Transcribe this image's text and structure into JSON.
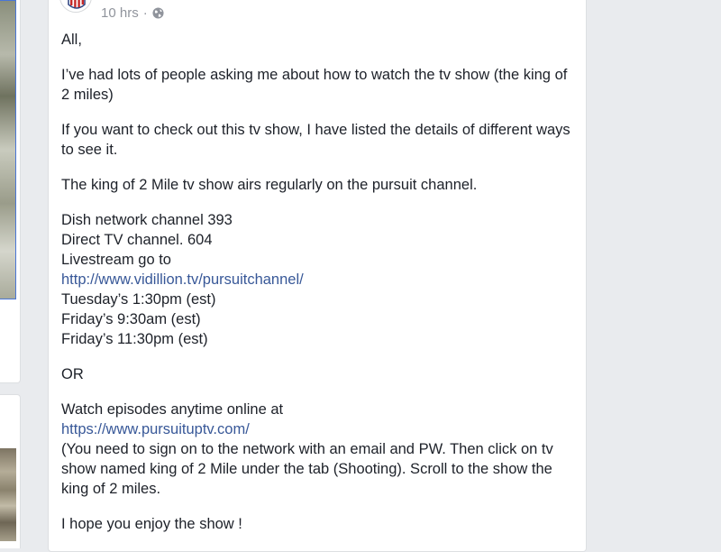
{
  "post": {
    "timestamp": "10 hrs",
    "separator": "·",
    "privacy_icon": "globe-icon",
    "greeting": "All,",
    "para1": "I’ve had lots of people asking me about how to watch the tv show (the king of 2 miles)",
    "para2": "If you want to check out this tv show, I have listed the details of different ways to see it.",
    "para3": "The king of 2 Mile tv show airs regularly on the pursuit channel.",
    "channels": {
      "dish": "Dish network channel 393",
      "directv": "Direct TV channel. 604",
      "livestream_label": "Livestream go to",
      "livestream_link": "http://www.vidillion.tv/pursuitchannel/",
      "time1": "Tuesday’s 1:30pm (est)",
      "time2": "Friday’s 9:30am (est)",
      "time3": "Friday’s 11:30pm (est)"
    },
    "or": "OR",
    "online": {
      "label": "Watch episodes anytime online at",
      "link": "https://www.pursuituptv.com/",
      "instructions": "(You need to sign on to the network with an email and PW. Then click on tv show named king of 2 Mile under the tab (Shooting). Scroll to the show the king of 2 miles."
    },
    "closing": "I hope you enjoy the show !"
  },
  "colors": {
    "link": "#385898",
    "text": "#1d2129",
    "meta": "#90949c",
    "page_bg": "#e9ebee"
  }
}
